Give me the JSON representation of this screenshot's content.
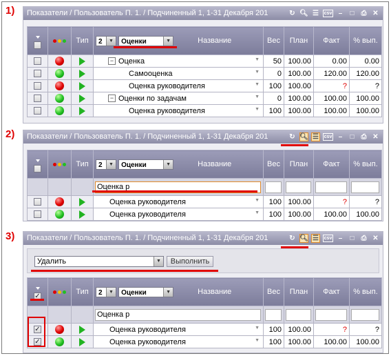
{
  "titlebar": {
    "path": "Показатели / Пользователь П. 1. / Подчиненный 1, 1-31 Декабря 201"
  },
  "icons": [
    "refresh-icon",
    "search-icon",
    "list-icon",
    "csv-icon",
    "minimize-icon",
    "maximize-icon",
    "print-icon",
    "close-icon"
  ],
  "steps": [
    "1)",
    "2)",
    "3)"
  ],
  "header": {
    "type_label": "Тип",
    "level_value": "2",
    "group_value": "Оценки",
    "name_label": "Название",
    "weight_label": "Вес",
    "plan_label": "План",
    "fact_label": "Факт",
    "pct_label": "% вып."
  },
  "panel1": {
    "rows": [
      {
        "status": "red",
        "name": "Оценка",
        "indent": 1,
        "expander": "−",
        "weight": "50",
        "plan": "100.00",
        "fact": "0.00",
        "pct": "0.00"
      },
      {
        "status": "green",
        "name": "Самооценка",
        "indent": 2,
        "expander": "",
        "weight": "0",
        "plan": "100.00",
        "fact": "120.00",
        "pct": "120.00"
      },
      {
        "status": "red",
        "name": "Оценка руководителя",
        "indent": 2,
        "expander": "",
        "weight": "100",
        "plan": "100.00",
        "fact": "?",
        "pct": "?"
      },
      {
        "status": "green",
        "name": "Оценки по задачам",
        "indent": 1,
        "expander": "−",
        "weight": "0",
        "plan": "100.00",
        "fact": "100.00",
        "pct": "100.00"
      },
      {
        "status": "green",
        "name": "Оценка руководителя",
        "indent": 2,
        "expander": "",
        "weight": "100",
        "plan": "100.00",
        "fact": "100.00",
        "pct": "100.00"
      }
    ]
  },
  "panel2": {
    "filter_value": "Оценка р",
    "rows": [
      {
        "status": "red",
        "name": "Оценка руководителя",
        "weight": "100",
        "plan": "100.00",
        "fact": "?",
        "pct": "?"
      },
      {
        "status": "green",
        "name": "Оценка руководителя",
        "weight": "100",
        "plan": "100.00",
        "fact": "100.00",
        "pct": "100.00"
      }
    ]
  },
  "panel3": {
    "action_value": "Удалить",
    "execute_label": "Выполнить",
    "filter_value": "Оценка р",
    "rows": [
      {
        "status": "red",
        "checked": "✓",
        "name": "Оценка руководителя",
        "weight": "100",
        "plan": "100.00",
        "fact": "?",
        "pct": "?"
      },
      {
        "status": "green",
        "checked": "✓",
        "name": "Оценка руководителя",
        "weight": "100",
        "plan": "100.00",
        "fact": "100.00",
        "pct": "100.00"
      }
    ],
    "header_checked": "✓"
  },
  "colors": {
    "accent_red": "#e00000",
    "titlebar": "#8c8ca6",
    "highlight": "#e08a2a",
    "status_red": "#e00000",
    "status_green": "#22c022"
  }
}
